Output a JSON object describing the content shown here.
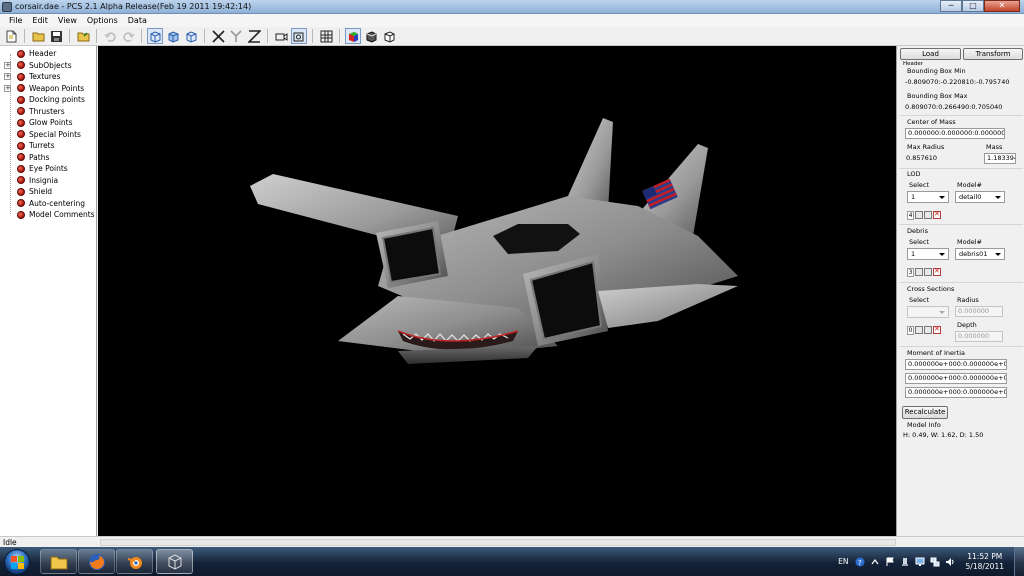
{
  "window": {
    "title": "corsair.dae - PCS 2.1 Alpha Release(Feb 19 2011 19:42:14)",
    "minimize": "─",
    "maximize": "□",
    "close": "✕"
  },
  "menu": [
    "File",
    "Edit",
    "View",
    "Options",
    "Data"
  ],
  "toolbar": {
    "icons": [
      "new-file-icon",
      "open-folder-icon",
      "save-disk-icon",
      "import-folder-icon",
      "undo-icon",
      "redo-icon",
      "wireframe-view-icon",
      "solid-view-icon",
      "textured-view-icon",
      "move-axis-icon",
      "rotate-axis-icon",
      "scale-axis-icon",
      "camera-icon",
      "camera-alt-icon",
      "grid-icon",
      "color-sphere-icon",
      "shaded-cube-icon",
      "outline-cube-icon"
    ]
  },
  "tree": {
    "items": [
      {
        "label": "Header",
        "expandable": false
      },
      {
        "label": "SubObjects",
        "expandable": true
      },
      {
        "label": "Textures",
        "expandable": true
      },
      {
        "label": "Weapon Points",
        "expandable": true
      },
      {
        "label": "Docking points",
        "expandable": false
      },
      {
        "label": "Thrusters",
        "expandable": false
      },
      {
        "label": "Glow Points",
        "expandable": false
      },
      {
        "label": "Special Points",
        "expandable": false
      },
      {
        "label": "Turrets",
        "expandable": false
      },
      {
        "label": "Paths",
        "expandable": false
      },
      {
        "label": "Eye Points",
        "expandable": false
      },
      {
        "label": "Insignia",
        "expandable": false
      },
      {
        "label": "Shield",
        "expandable": false
      },
      {
        "label": "Auto-centering",
        "expandable": false
      },
      {
        "label": "Model Comments",
        "expandable": false
      }
    ]
  },
  "panel": {
    "load_label": "Load",
    "transform_label": "Transform",
    "header_label": "Header",
    "bbox_min_label": "Bounding Box Min",
    "bbox_min_value": "-0.809070:-0.220810:-0.795740",
    "bbox_max_label": "Bounding Box Max",
    "bbox_max_value": "0.809070:0.266490:0.705040",
    "center_of_mass_label": "Center of Mass",
    "center_of_mass_value": "0.000000:0.000000:0.000000",
    "max_radius_label": "Max Radius",
    "max_radius_value": "0.857610",
    "mass_label": "Mass",
    "mass_value": "1.183394",
    "lod": {
      "label": "LOD",
      "select_label": "Select",
      "model_label": "Model#",
      "select_value": "1",
      "model_value": "detail0",
      "count": "4"
    },
    "debris": {
      "label": "Debris",
      "select_label": "Select",
      "model_label": "Model#",
      "select_value": "1",
      "model_value": "debris01",
      "count": "3"
    },
    "cross": {
      "label": "Cross Sections",
      "select_label": "Select",
      "radius_label": "Radius",
      "radius_value": "0.000000",
      "depth_label": "Depth",
      "depth_value": "0.000000",
      "count": "0"
    },
    "inertia": {
      "label": "Moment of Inertia",
      "rows": [
        "0.000000e+000:0.000000e+000",
        "0.000000e+000:0.000000e+000",
        "0.000000e+000:0.000000e+000"
      ]
    },
    "recalculate_label": "Recalculate",
    "model_info_label": "Model Info",
    "model_info_value": "H: 0.49, W: 1.62, D: 1.50"
  },
  "status": {
    "text": "Idle"
  },
  "taskbar": {
    "apps": [
      "folder-explorer-icon",
      "firefox-icon",
      "blender-icon",
      "pcs-app-icon"
    ],
    "language": "EN",
    "time": "11:52 PM",
    "date": "5/18/2011"
  },
  "colors": {
    "viewport_bg": "#000000",
    "tree_node_icon": "#b2180b",
    "taskbar": "#142238"
  }
}
